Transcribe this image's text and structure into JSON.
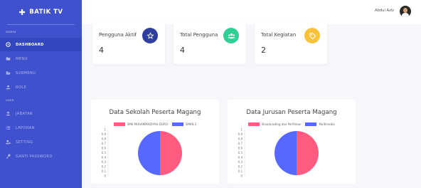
{
  "brand": {
    "name": "BATIK TV"
  },
  "sidebar": {
    "sections": [
      {
        "label": "ADMIN"
      },
      {
        "label": "USER"
      }
    ],
    "items": [
      {
        "label": "DASHBOARD",
        "icon": "dashboard-icon",
        "active": true
      },
      {
        "label": "MENU",
        "icon": "folder-icon"
      },
      {
        "label": "SUBMENU",
        "icon": "folder-open-icon"
      },
      {
        "label": "ROLE",
        "icon": "user-icon"
      },
      {
        "label": "JABATAN",
        "icon": "user-icon"
      },
      {
        "label": "LAPORAN",
        "icon": "list-icon"
      },
      {
        "label": "SETTING",
        "icon": "user-cog-icon"
      },
      {
        "label": "GANTI PASSWORD",
        "icon": "key-icon"
      }
    ]
  },
  "header": {
    "user_name": "Abdul Aziz"
  },
  "stats": [
    {
      "label": "Pengguna Aktif",
      "value": "4",
      "icon": "star-icon",
      "color": "#2f3f9e"
    },
    {
      "label": "Total Pengguna",
      "value": "4",
      "icon": "users-icon",
      "color": "#2fcf95"
    },
    {
      "label": "Total Kegiatan",
      "value": "2",
      "icon": "tag-icon",
      "color": "#f9c23c"
    }
  ],
  "chart_data": [
    {
      "type": "pie",
      "title": "Data Sekolah Peserta Magang",
      "categories": [
        "SMK MUHAMMADIYAH DORO",
        "SMKN 2"
      ],
      "values": [
        1,
        1
      ],
      "colors": [
        "#ff5c80",
        "#5768ff"
      ],
      "y_ticks": [
        "1",
        "0.9",
        "0.8",
        "0.7",
        "0.6",
        "0.5",
        "0.4",
        "0.3",
        "0.2",
        "0.1",
        "0"
      ],
      "legend": "top"
    },
    {
      "type": "pie",
      "title": "Data Jurusan Peserta Magang",
      "categories": [
        "Broadcasting dan Perfilman",
        "Multimedia"
      ],
      "values": [
        1,
        1
      ],
      "colors": [
        "#ff5c80",
        "#5768ff"
      ],
      "y_ticks": [
        "1",
        "0.9",
        "0.8",
        "0.7",
        "0.6",
        "0.5",
        "0.4",
        "0.3",
        "0.2",
        "0.1",
        "0"
      ],
      "legend": "top"
    }
  ]
}
